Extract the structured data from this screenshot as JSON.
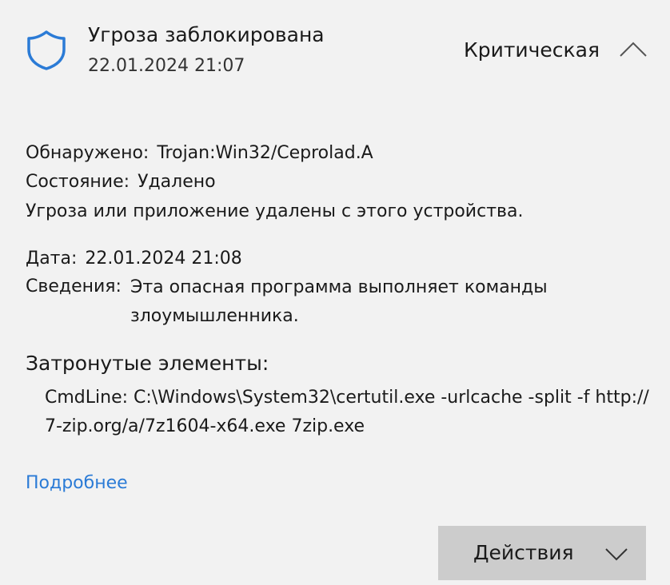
{
  "header": {
    "title": "Угроза заблокирована",
    "timestamp": "22.01.2024 21:07",
    "severity": "Критическая",
    "icon": "shield-icon",
    "collapse_icon": "chevron-up-icon"
  },
  "details": {
    "detected_label": "Обнаружено:",
    "detected_value": "Trojan:Win32/Ceprolad.A",
    "status_label": "Состояние:",
    "status_value": "Удалено",
    "status_note": "Угроза или приложение удалены с этого устройства.",
    "date_label": "Дата:",
    "date_value": "22.01.2024 21:08",
    "info_label": "Сведения:",
    "info_value": "Эта опасная программа выполняет команды злоумышленника."
  },
  "affected": {
    "title": "Затронутые элементы:",
    "items": [
      "CmdLine: C:\\Windows\\System32\\certutil.exe -urlcache -split -f http://7-zip.org/a/7z1604-x64.exe 7zip.exe"
    ]
  },
  "links": {
    "more": "Подробнее"
  },
  "actions": {
    "label": "Действия",
    "icon": "chevron-down-icon"
  },
  "colors": {
    "background": "#f2f2f2",
    "accent": "#2b7bd6",
    "button": "#cccccc"
  }
}
